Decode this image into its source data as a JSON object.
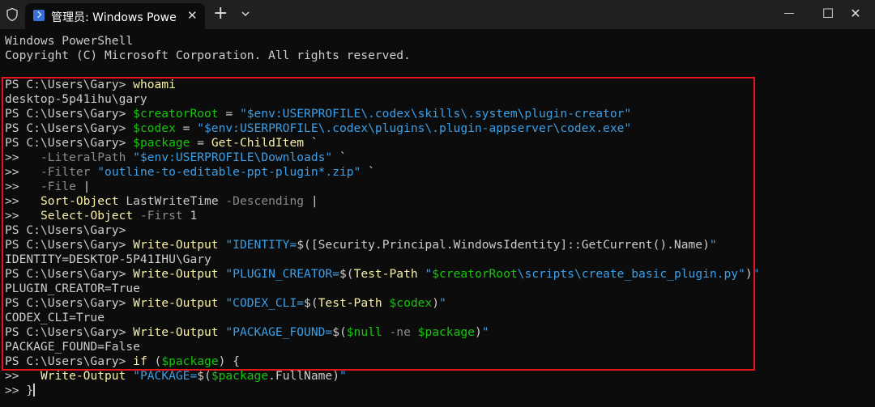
{
  "window": {
    "tab_title": "管理员: Windows PowerShell",
    "close_glyph": "✕",
    "new_tab_glyph": "+",
    "minimize_glyph": "—",
    "maximize_glyph": "☐",
    "window_close_glyph": "✕"
  },
  "colors": {
    "background": "#0c0c0c",
    "titlebar": "#202020",
    "text": "#cccccc",
    "command": "#f9f1a5",
    "variable": "#16c60c",
    "string": "#3b9fe8",
    "parameter": "#8b8b8b",
    "highlight_border": "#e8151b"
  },
  "terminal": {
    "lines": [
      [
        {
          "t": "Windows PowerShell",
          "s": "w"
        }
      ],
      [
        {
          "t": "Copyright (C) Microsoft Corporation. All rights reserved.",
          "s": "w"
        }
      ],
      [],
      [
        {
          "t": "PS C:\\Users\\Gary> ",
          "s": "w"
        },
        {
          "t": "whoami",
          "s": "y"
        }
      ],
      [
        {
          "t": "desktop-5p41ihu\\gary",
          "s": "w"
        }
      ],
      [
        {
          "t": "PS C:\\Users\\Gary> ",
          "s": "w"
        },
        {
          "t": "$creatorRoot",
          "s": "g"
        },
        {
          "t": " = ",
          "s": "w"
        },
        {
          "t": "\"$env:USERPROFILE\\.codex\\skills\\.system\\plugin-creator\"",
          "s": "c"
        }
      ],
      [
        {
          "t": "PS C:\\Users\\Gary> ",
          "s": "w"
        },
        {
          "t": "$codex",
          "s": "g"
        },
        {
          "t": " = ",
          "s": "w"
        },
        {
          "t": "\"$env:USERPROFILE\\.codex\\plugins\\.plugin-appserver\\codex.exe\"",
          "s": "c"
        }
      ],
      [
        {
          "t": "PS C:\\Users\\Gary> ",
          "s": "w"
        },
        {
          "t": "$package",
          "s": "g"
        },
        {
          "t": " = ",
          "s": "w"
        },
        {
          "t": "Get-ChildItem",
          "s": "y"
        },
        {
          "t": " `",
          "s": "w"
        }
      ],
      [
        {
          "t": ">>   ",
          "s": "w"
        },
        {
          "t": "-LiteralPath",
          "s": "d"
        },
        {
          "t": " ",
          "s": "w"
        },
        {
          "t": "\"$env:USERPROFILE\\Downloads\"",
          "s": "c"
        },
        {
          "t": " `",
          "s": "w"
        }
      ],
      [
        {
          "t": ">>   ",
          "s": "w"
        },
        {
          "t": "-Filter",
          "s": "d"
        },
        {
          "t": " ",
          "s": "w"
        },
        {
          "t": "\"outline-to-editable-ppt-plugin*.zip\"",
          "s": "c"
        },
        {
          "t": " `",
          "s": "w"
        }
      ],
      [
        {
          "t": ">>   ",
          "s": "w"
        },
        {
          "t": "-File",
          "s": "d"
        },
        {
          "t": " |",
          "s": "w"
        }
      ],
      [
        {
          "t": ">>   ",
          "s": "w"
        },
        {
          "t": "Sort-Object",
          "s": "y"
        },
        {
          "t": " LastWriteTime ",
          "s": "w"
        },
        {
          "t": "-Descending",
          "s": "d"
        },
        {
          "t": " |",
          "s": "w"
        }
      ],
      [
        {
          "t": ">>   ",
          "s": "w"
        },
        {
          "t": "Select-Object",
          "s": "y"
        },
        {
          "t": " ",
          "s": "w"
        },
        {
          "t": "-First",
          "s": "d"
        },
        {
          "t": " 1",
          "s": "w"
        }
      ],
      [
        {
          "t": "PS C:\\Users\\Gary>",
          "s": "w"
        }
      ],
      [
        {
          "t": "PS C:\\Users\\Gary> ",
          "s": "w"
        },
        {
          "t": "Write-Output",
          "s": "y"
        },
        {
          "t": " ",
          "s": "w"
        },
        {
          "t": "\"IDENTITY=",
          "s": "c"
        },
        {
          "t": "$([Security.Principal.WindowsIdentity]::GetCurrent().Name)",
          "s": "w"
        },
        {
          "t": "\"",
          "s": "c"
        }
      ],
      [
        {
          "t": "IDENTITY=DESKTOP-5P41IHU\\Gary",
          "s": "w"
        }
      ],
      [
        {
          "t": "PS C:\\Users\\Gary> ",
          "s": "w"
        },
        {
          "t": "Write-Output",
          "s": "y"
        },
        {
          "t": " ",
          "s": "w"
        },
        {
          "t": "\"PLUGIN_CREATOR=",
          "s": "c"
        },
        {
          "t": "$(",
          "s": "w"
        },
        {
          "t": "Test-Path",
          "s": "y"
        },
        {
          "t": " ",
          "s": "w"
        },
        {
          "t": "\"",
          "s": "c"
        },
        {
          "t": "$creatorRoot",
          "s": "g"
        },
        {
          "t": "\\scripts\\create_basic_plugin.py\"",
          "s": "c"
        },
        {
          "t": ")",
          "s": "w"
        },
        {
          "t": "\"",
          "s": "c"
        }
      ],
      [
        {
          "t": "PLUGIN_CREATOR=True",
          "s": "w"
        }
      ],
      [
        {
          "t": "PS C:\\Users\\Gary> ",
          "s": "w"
        },
        {
          "t": "Write-Output",
          "s": "y"
        },
        {
          "t": " ",
          "s": "w"
        },
        {
          "t": "\"CODEX_CLI=",
          "s": "c"
        },
        {
          "t": "$(",
          "s": "w"
        },
        {
          "t": "Test-Path",
          "s": "y"
        },
        {
          "t": " ",
          "s": "w"
        },
        {
          "t": "$codex",
          "s": "g"
        },
        {
          "t": ")",
          "s": "w"
        },
        {
          "t": "\"",
          "s": "c"
        }
      ],
      [
        {
          "t": "CODEX_CLI=True",
          "s": "w"
        }
      ],
      [
        {
          "t": "PS C:\\Users\\Gary> ",
          "s": "w"
        },
        {
          "t": "Write-Output",
          "s": "y"
        },
        {
          "t": " ",
          "s": "w"
        },
        {
          "t": "\"PACKAGE_FOUND=",
          "s": "c"
        },
        {
          "t": "$(",
          "s": "w"
        },
        {
          "t": "$null",
          "s": "g"
        },
        {
          "t": " ",
          "s": "w"
        },
        {
          "t": "-ne",
          "s": "d"
        },
        {
          "t": " ",
          "s": "w"
        },
        {
          "t": "$package",
          "s": "g"
        },
        {
          "t": ")",
          "s": "w"
        },
        {
          "t": "\"",
          "s": "c"
        }
      ],
      [
        {
          "t": "PACKAGE_FOUND=False",
          "s": "w"
        }
      ],
      [
        {
          "t": "PS C:\\Users\\Gary> ",
          "s": "w"
        },
        {
          "t": "if",
          "s": "y"
        },
        {
          "t": " (",
          "s": "w"
        },
        {
          "t": "$package",
          "s": "g"
        },
        {
          "t": ") {",
          "s": "w"
        }
      ],
      [
        {
          "t": ">>   ",
          "s": "w"
        },
        {
          "t": "Write-Output",
          "s": "y"
        },
        {
          "t": " ",
          "s": "w"
        },
        {
          "t": "\"PACKAGE=",
          "s": "c"
        },
        {
          "t": "$(",
          "s": "w"
        },
        {
          "t": "$package",
          "s": "g"
        },
        {
          "t": ".FullName)",
          "s": "w"
        },
        {
          "t": "\"",
          "s": "c"
        }
      ],
      [
        {
          "t": ">> }",
          "s": "w"
        }
      ]
    ]
  }
}
